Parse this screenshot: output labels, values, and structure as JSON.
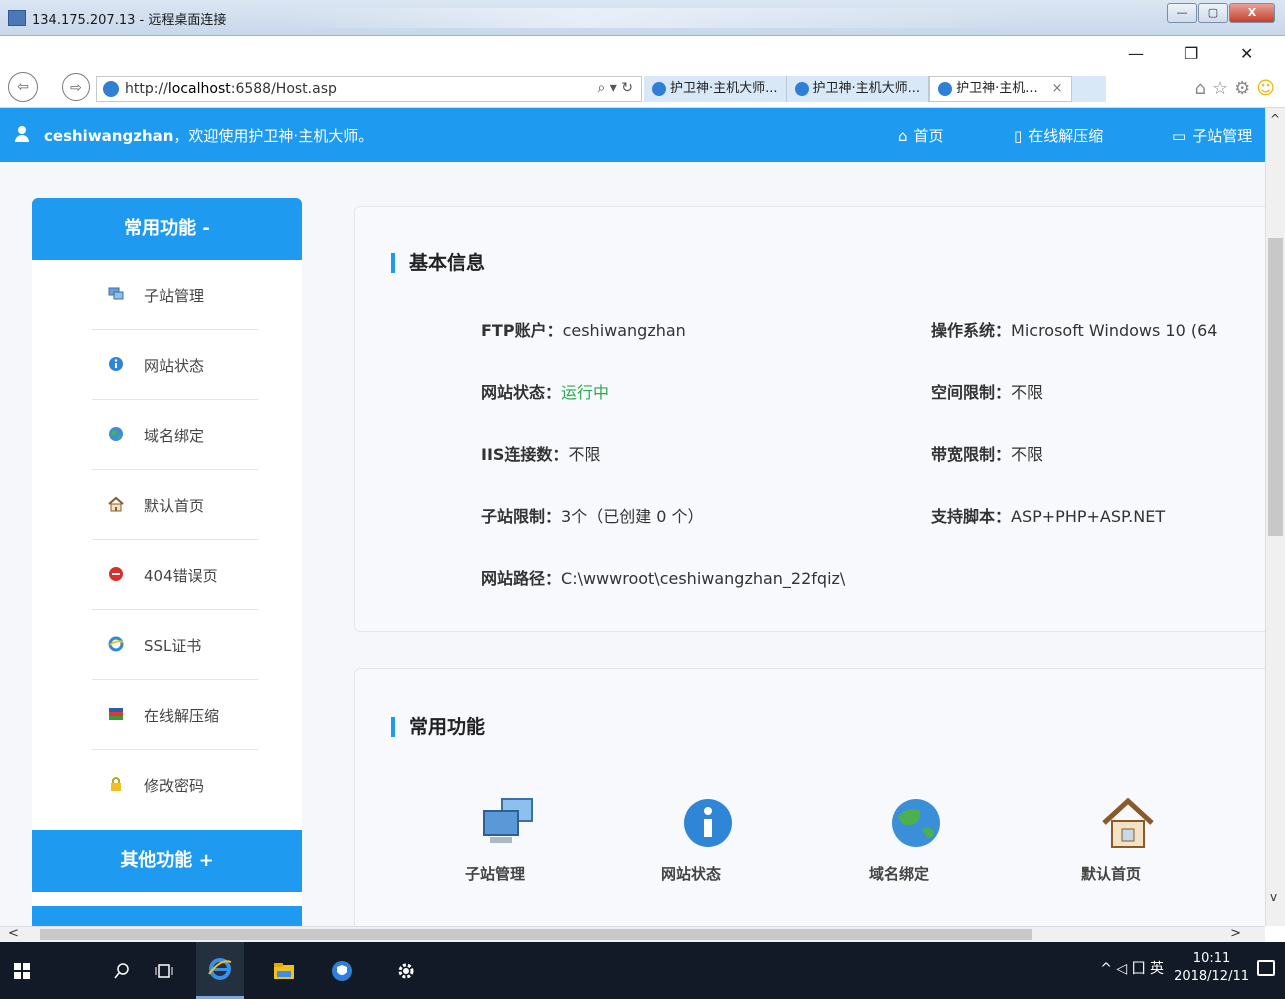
{
  "remote": {
    "title": "134.175.207.13 - 远程桌面连接",
    "controls": [
      "—",
      "▢",
      "X"
    ]
  },
  "browser": {
    "window_controls": [
      "—",
      "❐",
      "✕"
    ],
    "url_prefix": "http://",
    "url_host": "localhost",
    "url_rest": ":6588/Host.asp",
    "address_controls": "⌕ ▾ ↻",
    "tabs": [
      {
        "label": "护卫神·主机大师..."
      },
      {
        "label": "护卫神·主机大师..."
      },
      {
        "label": "护卫神·主机...",
        "close": "×"
      }
    ]
  },
  "topbar": {
    "username": "ceshiwangzhan",
    "welcome": "，欢迎使用护卫神·主机大师。",
    "nav": [
      {
        "label": "首页",
        "icon": "home-icon"
      },
      {
        "label": "在线解压缩",
        "icon": "file-icon"
      },
      {
        "label": "子站管理",
        "icon": "subsite-icon"
      }
    ]
  },
  "sidebar": {
    "section1": "常用功能 -",
    "items": [
      {
        "label": "子站管理",
        "icon": "computer-icon"
      },
      {
        "label": "网站状态",
        "icon": "info-icon"
      },
      {
        "label": "域名绑定",
        "icon": "globe-icon"
      },
      {
        "label": "默认首页",
        "icon": "home-icon"
      },
      {
        "label": "404错误页",
        "icon": "error-404-icon"
      },
      {
        "label": "SSL证书",
        "icon": "ssl-icon"
      },
      {
        "label": "在线解压缩",
        "icon": "archive-icon"
      },
      {
        "label": "修改密码",
        "icon": "lock-icon"
      }
    ],
    "section2": "其他功能 +"
  },
  "basic_info": {
    "title": "基本信息",
    "ftp_key": "FTP账户：",
    "ftp_val": "ceshiwangzhan",
    "status_key": "网站状态：",
    "status_val": "运行中",
    "iis_key": "IIS连接数：",
    "iis_val": "不限",
    "subsite_key": "子站限制：",
    "subsite_val": "3个（已创建 0 个）",
    "path_key": "网站路径：",
    "path_val": "C:\\wwwroot\\ceshiwangzhan_22fqiz\\",
    "os_key": "操作系统：",
    "os_val": "Microsoft Windows 10 (64",
    "space_key": "空间限制：",
    "space_val": "不限",
    "bw_key": "带宽限制：",
    "bw_val": "不限",
    "script_key": "支持脚本：",
    "script_val": "ASP+PHP+ASP.NET"
  },
  "common_functions": {
    "title": "常用功能",
    "items": [
      {
        "label": "子站管理",
        "icon": "computer-icon"
      },
      {
        "label": "网站状态",
        "icon": "info-icon"
      },
      {
        "label": "域名绑定",
        "icon": "globe-icon"
      },
      {
        "label": "默认首页",
        "icon": "home-icon"
      }
    ]
  },
  "taskbar": {
    "tray_text": "^ ◁ 囗 英",
    "time": "10:11",
    "date": "2018/12/11"
  },
  "colors": {
    "primary": "#1e9bf0",
    "running": "#2fa84f"
  }
}
